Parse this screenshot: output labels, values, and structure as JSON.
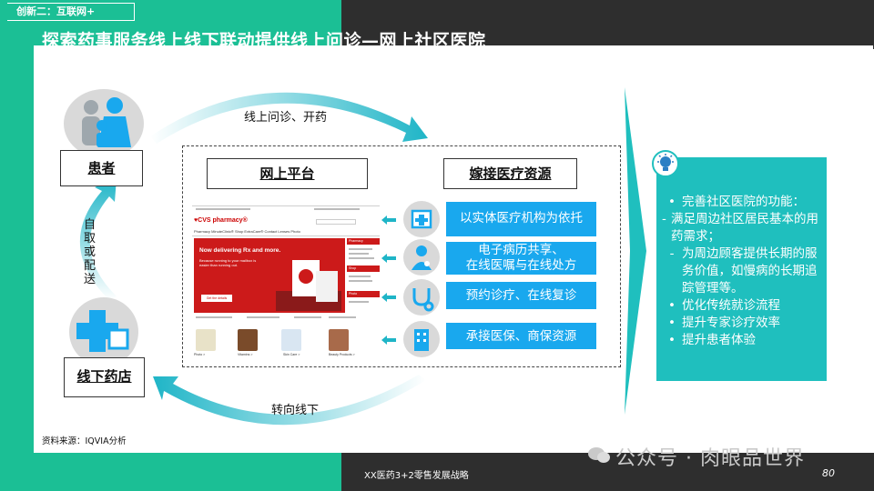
{
  "header": {
    "section_tag": "创新二：互联网+",
    "title": "探索药事服务线上线下联动提供线上问诊—网上社区医院"
  },
  "diagram": {
    "patient_label": "患者",
    "pharmacy_label": "线下药店",
    "top_arrow_label": "线上问诊、开药",
    "left_arrow_label": "自取或配送",
    "bottom_arrow_label": "转向线下",
    "platform_label": "网上平台",
    "resources_label": "嫁接医疗资源",
    "services": [
      {
        "line1": "以实体医疗机构为依托",
        "line2": "",
        "icon": "hospital-icon"
      },
      {
        "line1": "电子病历共享、",
        "line2": "在线医嘱与在线处方",
        "icon": "doctor-icon"
      },
      {
        "line1": "预约诊疗、在线复诊",
        "line2": "",
        "icon": "stethoscope-icon"
      },
      {
        "line1": "承接医保、商保资源",
        "line2": "",
        "icon": "insurance-building-icon"
      }
    ]
  },
  "cvs_screenshot": {
    "logo": "♥CVS pharmacy®",
    "nav": "Pharmacy  MinuteClinic®  Shop  ExtraCare®  Contact Lenses  Photo",
    "banner_title": "Now delivering Rx and more.",
    "banner_subtitle": "Because running to your mailbox is easier than running out.",
    "banner_button": "Get the details",
    "banner_badge": "♥CVS pharmacy",
    "side_headers": [
      "Pharmacy",
      "Shop",
      "Photo"
    ],
    "categories": [
      "Photo >",
      "Vitamins >",
      "Skin Care >",
      "Beauty Products >"
    ]
  },
  "benefits": [
    {
      "marker": "•",
      "text": "完善社区医院的功能："
    },
    {
      "marker": "-",
      "text": "满足周边社区居民基本的用药需求；"
    },
    {
      "marker": "-",
      "text": "为周边顾客提供长期的服务价值，如慢病的长期追踪管理等。"
    },
    {
      "marker": "•",
      "text": "优化传统就诊流程"
    },
    {
      "marker": "•",
      "text": "提升专家诊疗效率"
    },
    {
      "marker": "•",
      "text": "提升患者体验"
    }
  ],
  "footer": {
    "source": "资料来源：IQVIA分析",
    "title": "XX医药3+2零售发展战略",
    "page_number": "80",
    "watermark": "公众号 · 肉眼品世界"
  },
  "colors": {
    "teal": "#1bbf95",
    "dark": "#2e2e2e",
    "service_blue": "#19a8ee",
    "info_teal": "#1fbfbe",
    "cvs_red": "#cc1a1a"
  }
}
